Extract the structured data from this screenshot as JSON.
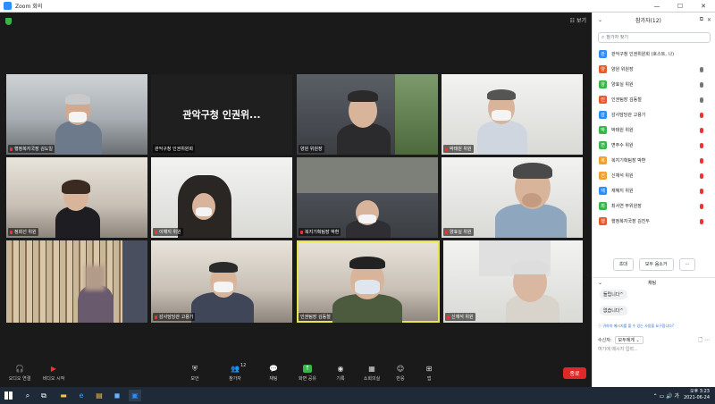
{
  "window": {
    "title": "Zoom 회의",
    "minimize": "—",
    "maximize": "☐",
    "close": "✕"
  },
  "view": {
    "label": "☷ 보기"
  },
  "tiles": [
    {
      "name": "행정복지국장 김도일"
    },
    {
      "name": "관악구청 인권위원회",
      "bigname": "관악구청 인권위..."
    },
    {
      "name": "양원 위원장"
    },
    {
      "name": "박태원 위원"
    },
    {
      "name": "정희선 위원"
    },
    {
      "name": "이해지 위원"
    },
    {
      "name": "복지기획팀장 박환"
    },
    {
      "name": "양효실 위원"
    },
    {
      "name": ""
    },
    {
      "name": "감사담당관 고용기"
    },
    {
      "name": "인권팀장 김동철"
    },
    {
      "name": "신재석 위원"
    }
  ],
  "toolbar": {
    "audio": "오디오 연결",
    "video": "비디오 시작",
    "security": "보안",
    "participants": "참가자",
    "participants_count": "12",
    "chat": "채팅",
    "share": "화면 공유",
    "record": "기록",
    "reactions": "소회의실",
    "apps": "반응",
    "more": "앱",
    "end": "종료"
  },
  "sidebar": {
    "title": "참가자(12)",
    "search_placeholder": "참가자 찾기",
    "participants": [
      {
        "initial": "관",
        "name": "관악구청 인권위원회 (호스트, 나)",
        "color": "#2d8cff",
        "mic": "none"
      },
      {
        "initial": "양",
        "name": "양원 위원장",
        "color": "#e65a2e",
        "mic": "on"
      },
      {
        "initial": "양",
        "name": "양효실 위원",
        "color": "#39b54a",
        "mic": "on"
      },
      {
        "initial": "인",
        "name": "인권팀장 김동철",
        "color": "#e65a2e",
        "mic": "on"
      },
      {
        "initial": "감",
        "name": "감사담당관 고용기",
        "color": "#2d8cff",
        "mic": "off"
      },
      {
        "initial": "박",
        "name": "박태원 위원",
        "color": "#39b54a",
        "mic": "off"
      },
      {
        "initial": "변",
        "name": "변주수 위원",
        "color": "#39b54a",
        "mic": "off"
      },
      {
        "initial": "복",
        "name": "복지기획팀장 박환",
        "color": "#f0a030",
        "mic": "off"
      },
      {
        "initial": "신",
        "name": "신재석 위원",
        "color": "#f0a030",
        "mic": "off"
      },
      {
        "initial": "재",
        "name": "재혜지 위원",
        "color": "#2d8cff",
        "mic": "off"
      },
      {
        "initial": "최",
        "name": "최서연 부위원장",
        "color": "#39b54a",
        "mic": "off"
      },
      {
        "initial": "행",
        "name": "행정복지국장 김진두",
        "color": "#e65a2e",
        "mic": "off"
      }
    ],
    "invite": "초대",
    "mute_all": "모두 음소거",
    "more": "...",
    "chat_title": "채팅",
    "messages": [
      "들립니다^",
      "없습니다^"
    ],
    "chat_note": "ⓘ 귀하의 메시지를 볼 수 있는 사람을 요구합니다?",
    "recipient_label": "수신자:",
    "recipient_value": "모두에게 ⌄",
    "input_placeholder": "여기에 메시지 입력..."
  },
  "taskbar": {
    "time": "오후 3:23",
    "date": "2021-06-24",
    "lang": "가"
  }
}
